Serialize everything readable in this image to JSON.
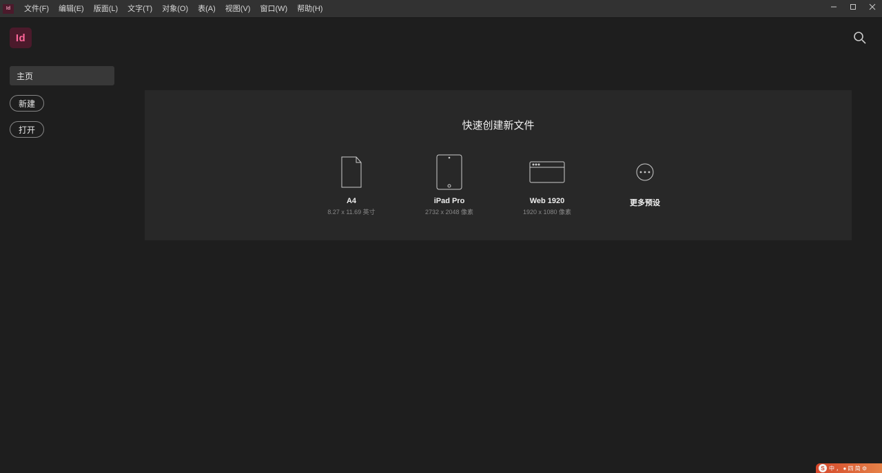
{
  "menubar": {
    "items": [
      "文件(F)",
      "编辑(E)",
      "版面(L)",
      "文字(T)",
      "对象(O)",
      "表(A)",
      "视图(V)",
      "窗口(W)",
      "帮助(H)"
    ]
  },
  "logo_text": "Id",
  "sidebar": {
    "home_tab": "主页",
    "new_button": "新建",
    "open_button": "打开"
  },
  "panel": {
    "title": "快速创建新文件",
    "presets": [
      {
        "label": "A4",
        "dims": "8.27 x 11.69 英寸"
      },
      {
        "label": "iPad Pro",
        "dims": "2732 x 2048 像素"
      },
      {
        "label": "Web 1920",
        "dims": "1920 x 1080 像素"
      }
    ],
    "more_label": "更多预设"
  },
  "ime": {
    "badge": "S",
    "text": "中 ， ● 四 简 ⚙"
  }
}
